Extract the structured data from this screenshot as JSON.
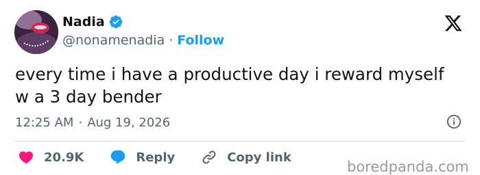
{
  "user": {
    "name": "Nadia",
    "handle": "@nonamenadia",
    "separator": "·",
    "follow_label": "Follow"
  },
  "tweet": {
    "text": "every time i have a productive day i reward myself\nw a 3 day bender",
    "time": "12:25 AM",
    "separator": "·",
    "date": "Aug 19, 2026"
  },
  "actions": {
    "likes_count": "20.9K",
    "reply_label": "Reply",
    "copy_link_label": "Copy link"
  },
  "watermark": "boredpanda.com",
  "colors": {
    "accent": "#1d9bf0",
    "like": "#f91880",
    "text": "#0f1419",
    "secondary": "#536471"
  },
  "icons": [
    "verified-badge-icon",
    "x-logo-icon",
    "info-icon",
    "heart-icon",
    "reply-bubble-icon",
    "link-icon"
  ]
}
